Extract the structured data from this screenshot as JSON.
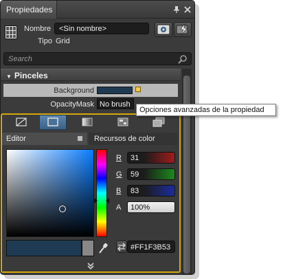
{
  "panel": {
    "title": "Propiedades"
  },
  "header": {
    "name_label": "Nombre",
    "name_value": "<Sin nombre>",
    "type_label": "Tipo",
    "type_value": "Grid"
  },
  "search": {
    "placeholder": "Search"
  },
  "section": {
    "title": "Pinceles"
  },
  "properties": [
    {
      "label": "Background",
      "value_color": "#1F3B53"
    },
    {
      "label": "OpacityMask",
      "value": "No brush"
    }
  ],
  "tooltip": {
    "text": "Opciones avanzadas de la propiedad"
  },
  "brush_tabs": [
    {
      "icon": "no-brush-icon"
    },
    {
      "icon": "solid-brush-icon",
      "active": true
    },
    {
      "icon": "gradient-brush-icon"
    },
    {
      "icon": "tile-brush-icon"
    },
    {
      "icon": "resource-brush-icon"
    }
  ],
  "editor_tabs": {
    "editor": "Editor",
    "resources": "Recursos de color"
  },
  "color": {
    "r_label": "R",
    "r": "31",
    "g_label": "G",
    "g": "59",
    "b_label": "B",
    "b": "83",
    "a_label": "A",
    "a": "100%",
    "hex": "#FF1F3B53",
    "current": "#1F3B53"
  },
  "colors": {
    "accent": "#D6A90B",
    "selected_tab": "#4A7299",
    "panel_bg": "#3B3B3B"
  }
}
